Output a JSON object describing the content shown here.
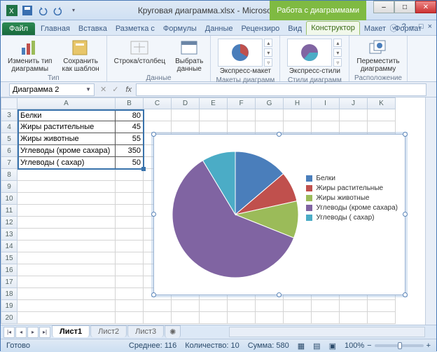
{
  "title": "Круговая диаграмма.xlsx - Microsoft Excel",
  "chart_tools_title": "Работа с диаграммами",
  "tabs": {
    "file": "Файл",
    "home": "Главная",
    "insert": "Вставка",
    "layout": "Разметка с",
    "formulas": "Формулы",
    "data": "Данные",
    "review": "Рецензиро",
    "view": "Вид",
    "designer": "Конструктор",
    "chart_layout": "Макет",
    "chart_format": "Формат"
  },
  "ribbon": {
    "change_type": "Изменить тип\nдиаграммы",
    "save_template": "Сохранить\nкак шаблон",
    "group_type": "Тип",
    "row_col": "Строка/столбец",
    "select_data": "Выбрать\nданные",
    "group_data": "Данные",
    "express_layout": "Экспресс-макет",
    "group_layouts": "Макеты диаграмм",
    "express_styles": "Экспресс-стили",
    "group_styles": "Стили диаграмм",
    "move_chart": "Переместить\nдиаграмму",
    "group_location": "Расположение"
  },
  "namebox": "Диаграмма 2",
  "fx": "fx",
  "columns": [
    "A",
    "B",
    "C",
    "D",
    "E",
    "F",
    "G",
    "H",
    "I",
    "J",
    "K"
  ],
  "rows_start": 3,
  "data_rows": [
    {
      "a": "Белки",
      "b": "80"
    },
    {
      "a": "Жиры растительные",
      "b": "45"
    },
    {
      "a": "Жиры животные",
      "b": "55"
    },
    {
      "a": "Углеводы (кроме сахара)",
      "b": "350"
    },
    {
      "a": "Углеводы ( сахар)",
      "b": "50"
    }
  ],
  "chart_data": {
    "type": "pie",
    "categories": [
      "Белки",
      "Жиры растительные",
      "Жиры животные",
      "Углеводы (кроме сахара)",
      "Углеводы ( сахар)"
    ],
    "values": [
      80,
      45,
      55,
      350,
      50
    ],
    "colors": [
      "#4a7ebb",
      "#c0504d",
      "#9bbb59",
      "#8064a2",
      "#4bacc6"
    ],
    "title": "",
    "legend_position": "right"
  },
  "sheets": {
    "s1": "Лист1",
    "s2": "Лист2",
    "s3": "Лист3"
  },
  "status": {
    "ready": "Готово",
    "avg_label": "Среднее:",
    "avg": "116",
    "count_label": "Количество:",
    "count": "10",
    "sum_label": "Сумма:",
    "sum": "580",
    "zoom": "100%"
  },
  "win": {
    "min": "–",
    "max": "□",
    "close": "✕",
    "help": "?"
  }
}
